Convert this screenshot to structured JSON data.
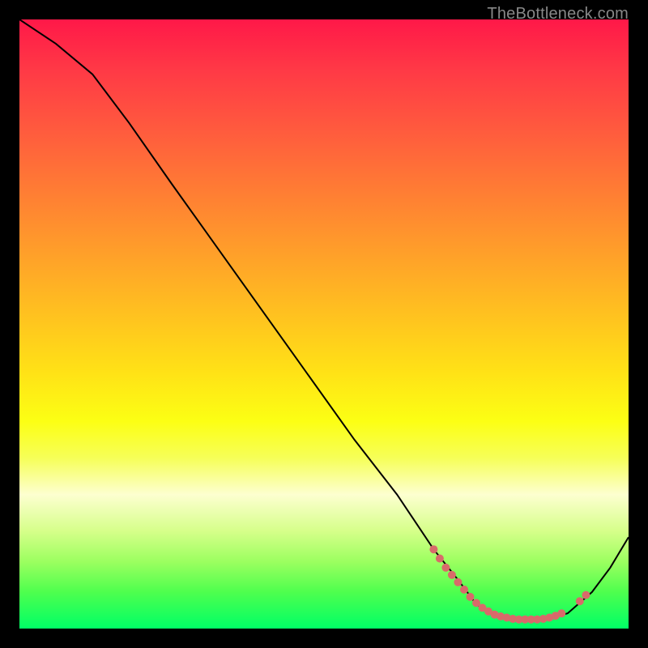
{
  "watermark": "TheBottleneck.com",
  "chart_data": {
    "type": "line",
    "title": "",
    "xlabel": "",
    "ylabel": "",
    "xlim": [
      0,
      100
    ],
    "ylim": [
      0,
      100
    ],
    "background_gradient": {
      "top_color": "#ff1848",
      "mid_color": "#ffe216",
      "bottom_color": "#00ff66"
    },
    "curve": [
      {
        "x": 0,
        "y": 100
      },
      {
        "x": 6,
        "y": 96
      },
      {
        "x": 12,
        "y": 91
      },
      {
        "x": 18,
        "y": 83
      },
      {
        "x": 25,
        "y": 73
      },
      {
        "x": 35,
        "y": 59
      },
      {
        "x": 45,
        "y": 45
      },
      {
        "x": 55,
        "y": 31
      },
      {
        "x": 62,
        "y": 22
      },
      {
        "x": 68,
        "y": 13
      },
      {
        "x": 72,
        "y": 8
      },
      {
        "x": 75,
        "y": 4
      },
      {
        "x": 78,
        "y": 2
      },
      {
        "x": 82,
        "y": 1.5
      },
      {
        "x": 86,
        "y": 1.5
      },
      {
        "x": 90,
        "y": 2.5
      },
      {
        "x": 94,
        "y": 6
      },
      {
        "x": 97,
        "y": 10
      },
      {
        "x": 100,
        "y": 15
      }
    ],
    "points": [
      {
        "x": 68,
        "y": 13
      },
      {
        "x": 69,
        "y": 11.5
      },
      {
        "x": 70,
        "y": 10
      },
      {
        "x": 71,
        "y": 8.8
      },
      {
        "x": 72,
        "y": 7.6
      },
      {
        "x": 73,
        "y": 6.4
      },
      {
        "x": 74,
        "y": 5.2
      },
      {
        "x": 75,
        "y": 4.2
      },
      {
        "x": 76,
        "y": 3.4
      },
      {
        "x": 77,
        "y": 2.8
      },
      {
        "x": 78,
        "y": 2.3
      },
      {
        "x": 79,
        "y": 2.0
      },
      {
        "x": 80,
        "y": 1.8
      },
      {
        "x": 81,
        "y": 1.6
      },
      {
        "x": 82,
        "y": 1.5
      },
      {
        "x": 83,
        "y": 1.5
      },
      {
        "x": 84,
        "y": 1.5
      },
      {
        "x": 85,
        "y": 1.5
      },
      {
        "x": 86,
        "y": 1.6
      },
      {
        "x": 87,
        "y": 1.8
      },
      {
        "x": 88,
        "y": 2.1
      },
      {
        "x": 89,
        "y": 2.5
      },
      {
        "x": 92,
        "y": 4.5
      },
      {
        "x": 93,
        "y": 5.5
      }
    ]
  }
}
